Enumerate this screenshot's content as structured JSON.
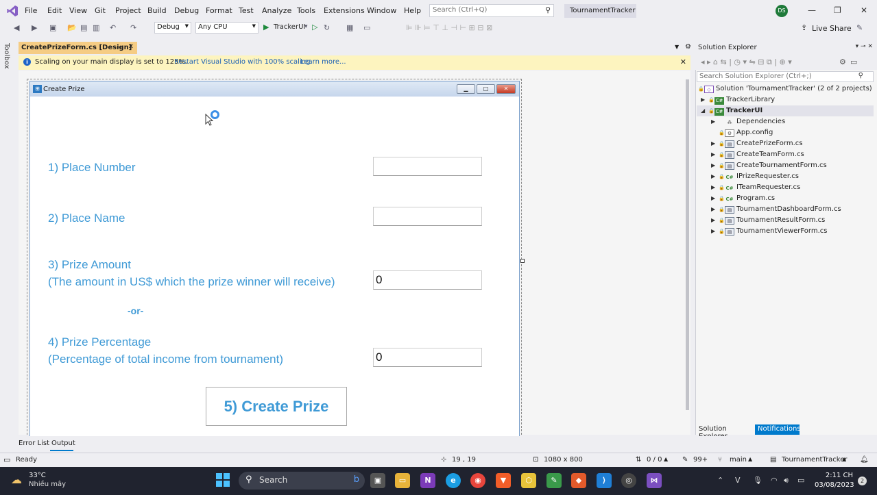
{
  "menubar": {
    "items": [
      "File",
      "Edit",
      "View",
      "Git",
      "Project",
      "Build",
      "Debug",
      "Format",
      "Test",
      "Analyze",
      "Tools",
      "Extensions",
      "Window",
      "Help"
    ],
    "search_placeholder": "Search (Ctrl+Q)",
    "solution_name": "TournamentTracker",
    "user_initials": "DS"
  },
  "toolbar": {
    "config": "Debug",
    "platform": "Any CPU",
    "start_target": "TrackerUI",
    "live_share": "Live Share"
  },
  "left_strip": {
    "toolbox": "Toolbox"
  },
  "document_tab": {
    "title": "CreatePrizeForm.cs [Design]"
  },
  "infobar": {
    "message": "Scaling on your main display is set to 125%.",
    "restart_link": "Restart Visual Studio with 100% scaling.",
    "learn_more": "Learn more..."
  },
  "form": {
    "title": "Create Prize",
    "place_number_label": "1) Place Number",
    "place_number_value": "",
    "place_name_label": "2) Place Name",
    "place_name_value": "",
    "prize_amount_label": "3) Prize Amount",
    "prize_amount_sub": "(The amount in US$ which the prize winner will receive)",
    "prize_amount_value": "0",
    "or_label": "-or-",
    "prize_percentage_label": "4) Prize Percentage",
    "prize_percentage_sub": "(Percentage of total income from tournament)",
    "prize_percentage_value": "0",
    "create_button": "5) Create Prize"
  },
  "solution_explorer": {
    "title": "Solution Explorer",
    "search_placeholder": "Search Solution Explorer (Ctrl+;)",
    "solution": "Solution 'TournamentTracker' (2 of 2 projects)",
    "projects": {
      "library": "TrackerLibrary",
      "ui": "TrackerUI"
    },
    "files": [
      "Dependencies",
      "App.config",
      "CreatePrizeForm.cs",
      "CreateTeamForm.cs",
      "CreateTournamentForm.cs",
      "IPrizeRequester.cs",
      "ITeamRequester.cs",
      "Program.cs",
      "TournamentDashboardForm.cs",
      "TournamentResultForm.cs",
      "TournamentViewerForm.cs"
    ],
    "tab_solution_explorer": "Solution Explorer",
    "tab_notifications": "Notifications"
  },
  "bottom_tabs": {
    "error_list": "Error List",
    "output": "Output"
  },
  "statusbar": {
    "ready": "Ready",
    "position": "19 , 19",
    "size": "1080 x 800",
    "changes": "0 / 0",
    "edits": "99+",
    "branch": "main",
    "repo": "TournamentTracker"
  },
  "taskbar": {
    "temperature": "33°C",
    "weather": "Nhiều mây",
    "search": "Search",
    "time": "2:11 CH",
    "date": "03/08/2023",
    "notifications": "2"
  }
}
